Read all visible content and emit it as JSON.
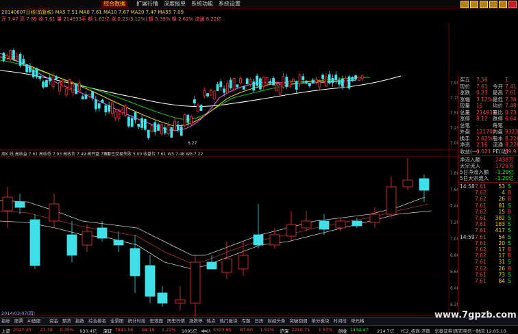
{
  "menubar": {
    "items": [
      "综合数据",
      "扩展行情",
      "深度报单",
      "系统功能",
      "系统设置"
    ],
    "active": 0
  },
  "info_line1": {
    "text": "20140607日线(前复权) MA5 7.51 MA8 7.61 MA10 7.67 MA20 7.47 MA55 7.09"
  },
  "info_line2": {
    "text": "开 7.47 高 7.89 收 7.61 量 214933手 额 1.62亿 涨 0.23(3.12%) 振 5.39% 换 2.62% 流通 8.22亿"
  },
  "sub_indicator": {
    "label": "周K 线 高收益 7.61 高收低 7.93 高收负 7.49 高开盘 7.81",
    "label2": "五周已交易失败 5.00 收盘位 7.61 W5 7.48 W8 7.22"
  },
  "chart_data": {
    "type": "candlestick",
    "panels": [
      "日线 price with moving averages",
      "周线 candlestick with bands"
    ],
    "price_axis_top": [
      "7.90",
      "7.75",
      "7.50",
      "7.25",
      "7.00"
    ],
    "price_axis_bottom": [
      "7.80",
      "7.60",
      "7.40",
      "7.20",
      "7.00",
      "6.80",
      "6.60",
      "6.40",
      "6.20"
    ],
    "low_marker": "6.27"
  },
  "right_panel": {
    "rows": [
      {
        "label": "买五",
        "value": "7.56",
        "label2": "",
        "value2": "1"
      },
      {
        "label": "现价",
        "value": "7.61",
        "label2": "今开",
        "value2": "7.41"
      },
      {
        "label": "涨跌",
        "value": "0.23",
        "label2": "最高",
        "value2": "7.61"
      },
      {
        "label": "涨幅",
        "value": "3.12%",
        "label2": "最低",
        "value2": "7.38"
      },
      {
        "label": "现量",
        "value": "16",
        "label2": "均价",
        "value2": "7.48"
      },
      {
        "label": "总量",
        "value": "214933",
        "label2": "量比",
        "value2": "0.73"
      },
      {
        "label": "涨停",
        "value": "8.12",
        "label2": "跌停",
        "value2": "6.64"
      },
      {
        "label": "总笔",
        "value": "-",
        "label2": "每笔",
        "value2": ""
      },
      {
        "label": "外盘",
        "value": "121703",
        "label2": "内盘",
        "value2": "93230"
      },
      {
        "label": "换手",
        "value": "2.62%",
        "label2": "股本",
        "value2": "8.22亿"
      },
      {
        "label": "净资",
        "value": "2.16",
        "label2": "流通",
        "value2": "8.22亿"
      },
      {
        "label": "收益(一)",
        "value": "0.021",
        "label2": "PE(动)",
        "value2": "89.9"
      }
    ],
    "flow": [
      {
        "label": "净流入额",
        "value": "2438万"
      },
      {
        "label": "大宗流入",
        "value": "1729万"
      },
      {
        "label": "5日净流入额",
        "value": "-1.29亿"
      },
      {
        "label": "5日大宗流入",
        "value": "-1.20亿"
      }
    ],
    "ticks": [
      {
        "time": "14:58",
        "price": "7.61",
        "vol": "53",
        "flag": "S"
      },
      {
        "time": "",
        "price": "7.62",
        "vol": "4",
        "flag": "B"
      },
      {
        "time": "",
        "price": "7.62",
        "vol": "26",
        "flag": "B"
      },
      {
        "time": "",
        "price": "7.61",
        "vol": "81",
        "flag": "S"
      },
      {
        "time": "",
        "price": "7.62",
        "vol": "15",
        "flag": "B"
      },
      {
        "time": "",
        "price": "7.61",
        "vol": "382",
        "flag": "S"
      },
      {
        "time": "",
        "price": "7.61",
        "vol": "183",
        "flag": "S"
      },
      {
        "time": "",
        "price": "7.61",
        "vol": "417",
        "flag": "S"
      },
      {
        "time": "14:59",
        "price": "7.61",
        "vol": "54",
        "flag": "S"
      },
      {
        "time": "",
        "price": "7.61",
        "vol": "20",
        "flag": "S"
      },
      {
        "time": "",
        "price": "7.62",
        "vol": "17",
        "flag": "B"
      },
      {
        "time": "",
        "price": "7.62",
        "vol": "17",
        "flag": "B"
      },
      {
        "time": "",
        "price": "7.61",
        "vol": "31",
        "flag": "S"
      },
      {
        "time": "",
        "price": "7.62",
        "vol": "26",
        "flag": "B"
      },
      {
        "time": "",
        "price": "7.61",
        "vol": "73",
        "flag": "S"
      },
      {
        "time": "",
        "price": "7.61",
        "vol": "84",
        "flag": "S"
      }
    ]
  },
  "bottom_date": "2014/03/07(四)",
  "tabs": [
    "指标",
    "股票",
    "AI选股",
    "资金",
    "期货",
    "指数",
    "综合排名",
    "全景图",
    "统计时段",
    "宏观面",
    "历史行情",
    "涨跌停",
    "热点",
    "热门板块",
    "专题",
    "日历",
    "财经头条",
    "突破回调",
    "单分板块",
    "时间段",
    "单元格"
  ],
  "status": [
    {
      "text": "上证",
      "color": "#ffffff"
    },
    {
      "text": "2027.35",
      "color": "#ff4040"
    },
    {
      "text": "21.38",
      "color": "#ff4040"
    },
    {
      "text": "0.35%",
      "color": "#ff4040"
    },
    {
      "text": "930.4亿",
      "color": "#c8c8c8"
    },
    {
      "text": "深证",
      "color": "#ffffff"
    },
    {
      "text": "7841.56",
      "color": "#ff4040"
    },
    {
      "text": "94.19",
      "color": "#ff4040"
    },
    {
      "text": "1.22%",
      "color": "#ff4040"
    },
    {
      "text": "1095亿",
      "color": "#c8c8c8"
    },
    {
      "text": "中小",
      "color": "#ffffff"
    },
    {
      "text": "5323.85",
      "color": "#ff4040"
    },
    {
      "text": "87.60",
      "color": "#ff4040"
    },
    {
      "text": "1.52%",
      "color": "#ff4040"
    },
    {
      "text": "沪深",
      "color": "#ffffff"
    },
    {
      "text": "2210.71",
      "color": "#ff4040"
    },
    {
      "text": "1.57%",
      "color": "#ff4040"
    },
    {
      "text": "创业",
      "color": "#ffffff"
    },
    {
      "text": "1434.47",
      "color": "#00ff00"
    },
    {
      "text": "214.7亿",
      "color": "#c8c8c8"
    },
    {
      "text": "YC2_招商·济南",
      "color": "#c8c8c8"
    },
    {
      "text": "华泰证券(周市电信一)",
      "color": "#c8c8c8"
    },
    {
      "text": "时间 12:05:16",
      "color": "#c8c8c8"
    }
  ],
  "watermark": "www.7gpzb.com",
  "colors": {
    "up": "#ff3030",
    "down": "#40e0e8",
    "ma5": "#ffffff",
    "ma10": "#ffd700",
    "ma20": "#ff60ff",
    "ma55": "#00cc00"
  }
}
